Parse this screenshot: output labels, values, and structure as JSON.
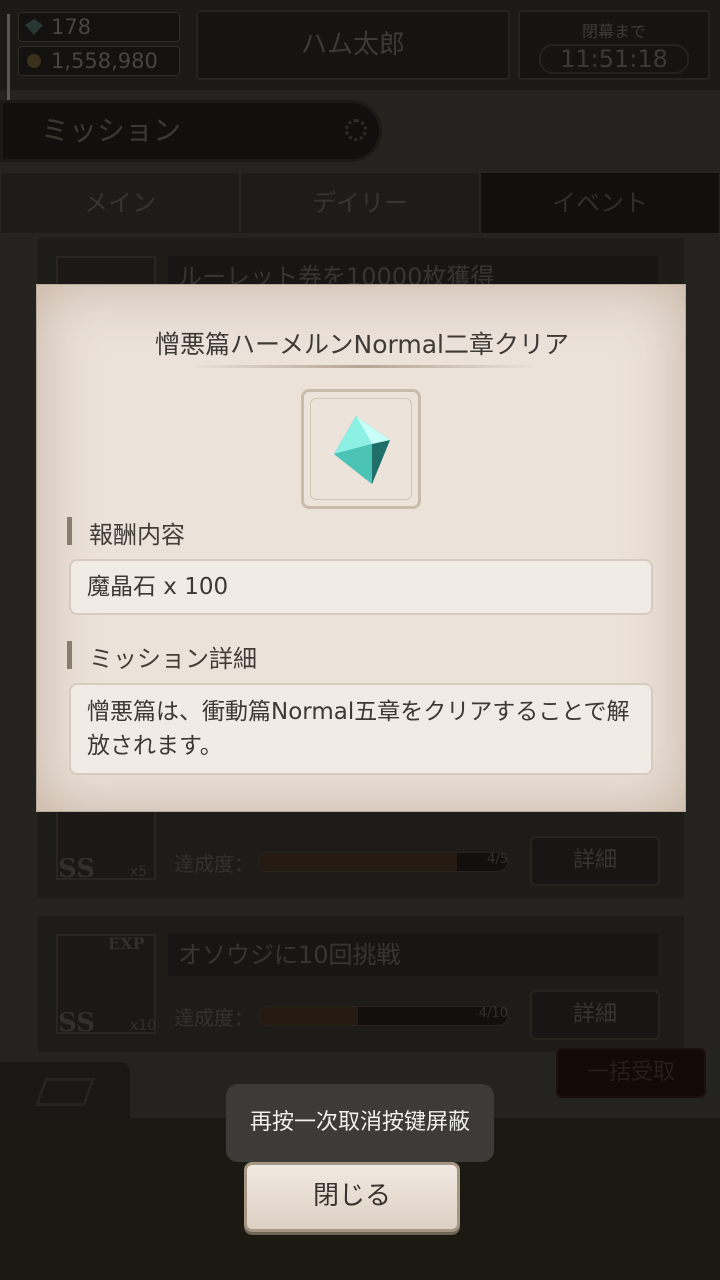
{
  "status_bar": {
    "crystals": "178",
    "gold": "1,558,980",
    "player_name": "ハム太郎",
    "timer_label": "閉幕まで",
    "timer_value": "11:51:18"
  },
  "header": {
    "title": "ミッション"
  },
  "tabs": [
    {
      "label": "メイン"
    },
    {
      "label": "デイリー"
    },
    {
      "label": "イベント",
      "active": true
    }
  ],
  "background_missions": [
    {
      "title": "ルーレット券を10000枚獲得"
    },
    {
      "rank": "SS",
      "count": "x5",
      "progress_label": "達成度：",
      "progress_text": "4/5",
      "progress": 0.8,
      "detail_label": "詳細"
    },
    {
      "badge": "EXP",
      "title": "オソウジに10回挑戦",
      "rank": "SS",
      "count": "x10",
      "progress_label": "達成度：",
      "progress_text": "4/10",
      "progress": 0.4,
      "detail_label": "詳細"
    }
  ],
  "footer": {
    "collect_all": "一括受取"
  },
  "modal": {
    "title": "憎悪篇ハーメルンNormal二章クリア",
    "reward_icon": "magic-crystal-icon",
    "reward_section_label": "報酬内容",
    "reward_value": "魔晶石 x 100",
    "detail_section_label": "ミッション詳細",
    "detail_value": "憎悪篇は、衝動篇Normal五章をクリアすることで解放されます。"
  },
  "toast": {
    "message": "再按一次取消按键屏蔽"
  },
  "close_button": {
    "label": "閉じる"
  },
  "colors": {
    "modal_bg": "#ebe2da",
    "crystal": "#5fd6c9",
    "toast_bg": "#3e3c39"
  }
}
